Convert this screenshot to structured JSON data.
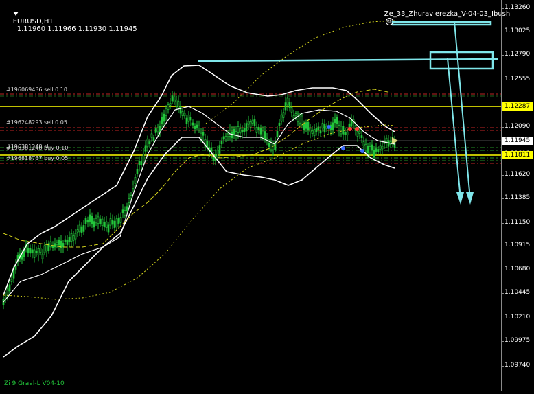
{
  "header": {
    "symbol_timeframe": "EURUSD,H1",
    "ohlc": "1.11960 1.11966 1.11930 1.11945",
    "expert_name": "Ze_33_Zhuravlerezka_V-04-03_Ibush",
    "expert_icon": "smiley-icon"
  },
  "footer": {
    "indicator_label": "Zi 9 Graal-L V04-10"
  },
  "price_axis": {
    "labels": [
      "1.13260",
      "1.13025",
      "1.12790",
      "1.12555",
      "1.12287",
      "1.12090",
      "1.11945",
      "1.11811",
      "1.11620",
      "1.11385",
      "1.11150",
      "1.10915",
      "1.10680",
      "1.10445",
      "1.10210",
      "1.09975",
      "1.09740"
    ],
    "current_price": "1.11945",
    "level_high": "1.12287",
    "level_low": "1.11811"
  },
  "orders": [
    {
      "text": "#196069436 sell 0.10"
    },
    {
      "text": "#196248293 sell 0.05"
    },
    {
      "text": "#196381248 sl"
    },
    {
      "text": "#196381248 buy 0.10"
    },
    {
      "text": "#196818737 buy 0.05"
    }
  ],
  "colors": {
    "background": "#000000",
    "candle_bull": "#22c53a",
    "bands": "#ffffff",
    "ma_dashed": "#d6d61e",
    "level_yellow": "#ffff00",
    "trendline": "#7fe6ea",
    "order_sell": "#ff3030",
    "order_buy": "#30c030"
  }
}
